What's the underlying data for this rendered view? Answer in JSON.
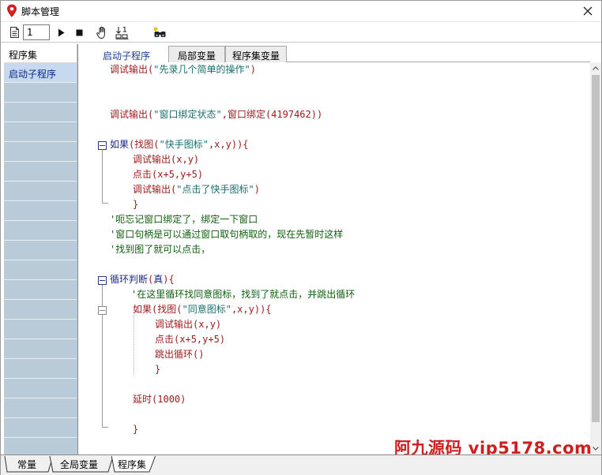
{
  "window": {
    "title": "脚本管理"
  },
  "toolbar": {
    "number_value": "1"
  },
  "left_panel": {
    "header": "程序集",
    "items": [
      "启动子程序"
    ]
  },
  "tabs": [
    "启动子程序",
    "局部变量",
    "程序集变量"
  ],
  "code": {
    "l1": {
      "fn": "调试输出",
      "a": "(",
      "str": "\"先录几个简单的操作\"",
      "b": ")"
    },
    "l2": {
      "fn": "调试输出",
      "a": "(",
      "str": "\"窗口绑定状态\"",
      "b": ",",
      "fn2": "窗口绑定",
      "c": "(4197462))"
    },
    "l3": {
      "kw": "如果",
      "a": "(",
      "fn": "找图",
      "b": "(",
      "str": "\"快手图标\"",
      "c": ",x,y)){"
    },
    "l4": {
      "fn": "调试输出",
      "a": "(x,y)"
    },
    "l5": {
      "fn": "点击",
      "a": "(x+5,y+5)"
    },
    "l6": {
      "fn": "调试输出",
      "a": "(",
      "str": "\"点击了快手图标\"",
      "b": ")"
    },
    "l7": {
      "a": "}"
    },
    "c1": "'呃忘记窗口绑定了，绑定一下窗口",
    "c2": "'窗口句柄是可以通过窗口取句柄取的，现在先暂时这样",
    "c3": "'找到图了就可以点击，",
    "l8": {
      "kw": "循环判断",
      "a": "(",
      "kw2": "真",
      "b": "){"
    },
    "c4": "'在这里循环找同意图标，找到了就点击，并跳出循环",
    "l9": {
      "kw": "如果",
      "a": "(",
      "fn": "找图",
      "b": "(",
      "str": "\"同意图标\"",
      "c": ",x,y)){"
    },
    "l10": {
      "fn": "调试输出",
      "a": "(x,y)"
    },
    "l11": {
      "fn": "点击",
      "a": "(x+5,y+5)"
    },
    "l12": {
      "fn": "跳出循环",
      "a": "()"
    },
    "l13": {
      "a": "}"
    },
    "l14": {
      "fn": "延时",
      "a": "(1000)"
    },
    "l15": {
      "a": "}"
    }
  },
  "bottom_tabs": [
    "常量",
    "全局变量",
    "程序集"
  ],
  "watermark": "阿九源码  vip5178.com",
  "colors": {
    "selection": "#c7d9ee",
    "left_panel": "#b9cbd8",
    "watermark": "#cc1f1f",
    "keyword": "#1f2b8a",
    "function": "#9a1b1b",
    "string": "#1a6f6f",
    "comment": "#0f5f0f"
  },
  "icons": [
    "location-pin-icon",
    "close-icon",
    "document-icon",
    "play-icon",
    "stop-icon",
    "hand-icon",
    "record-steps-icon",
    "find-icon",
    "fold-minus-icon"
  ]
}
